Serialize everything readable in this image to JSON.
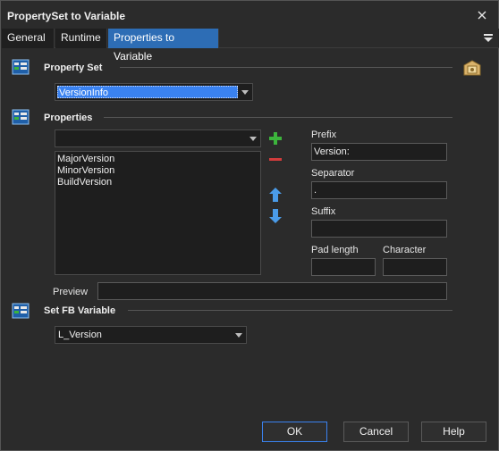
{
  "window": {
    "title": "PropertySet to Variable"
  },
  "tabs": [
    {
      "label": "General"
    },
    {
      "label": "Runtime"
    },
    {
      "label": "Properties to Variable"
    }
  ],
  "property_set": {
    "heading": "Property Set",
    "selected": "VersionInfo"
  },
  "properties": {
    "heading": "Properties",
    "combo_value": "",
    "items": [
      "MajorVersion",
      "MinorVersion",
      "BuildVersion"
    ],
    "prefix_label": "Prefix",
    "prefix_value": "Version:",
    "separator_label": "Separator",
    "separator_value": ".",
    "suffix_label": "Suffix",
    "suffix_value": "",
    "pad_length_label": "Pad length",
    "pad_length_value": "",
    "character_label": "Character",
    "character_value": "",
    "preview_label": "Preview",
    "preview_value": ""
  },
  "set_fb_variable": {
    "heading": "Set FB Variable",
    "selected": "L_Version"
  },
  "buttons": {
    "ok": "OK",
    "cancel": "Cancel",
    "help": "Help"
  },
  "colors": {
    "background": "#2b2b2b",
    "active_tab": "#2d6db5",
    "selection": "#3a82f0",
    "add_icon": "#3cb43c",
    "remove_icon": "#d23c3c",
    "arrow_icon": "#4a9be8"
  }
}
